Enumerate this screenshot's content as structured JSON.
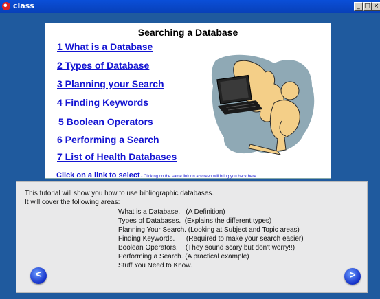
{
  "window": {
    "title": "class",
    "min_glyph": "_",
    "max_glyph": "□",
    "close_glyph": "×"
  },
  "menu": {
    "title": "Searching a Database",
    "links": [
      "1 What is a Database",
      "2 Types of Database",
      "3 Planning your Search",
      "4 Finding Keywords",
      "5 Boolean Operators",
      "6 Performing a Search",
      "7 List of Health Databases"
    ],
    "hint_main": "Click on a link to select",
    "hint_sub": " - Clicking on the same link on a screen will bring you back here"
  },
  "intro": {
    "line1": "This tutorial will show you how to use bibliographic databases.",
    "line2": "It will cover the following areas:",
    "areas": [
      "What is a Database.   (A Definition)",
      "Types of Databases.  (Explains the different types)",
      "Planning Your Search. (Looking at Subject and Topic areas)",
      "Finding Keywords.      (Required to make your search easier)",
      "Boolean Operators.    (They sound scary but don't worry!!)",
      "Performing a Search. (A practical example)",
      "Stuff You Need to Know."
    ]
  },
  "nav": {
    "prev": "<",
    "next": ">"
  }
}
